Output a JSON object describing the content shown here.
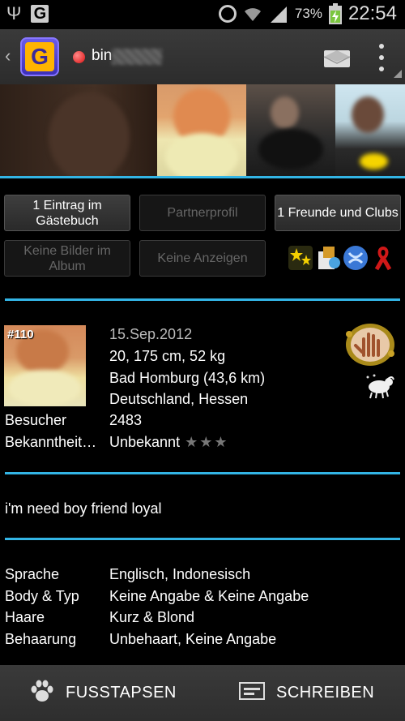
{
  "status_bar": {
    "battery_percent": "73%",
    "time": "22:54",
    "icons": [
      "usb-icon",
      "g-notification-icon",
      "alarm-icon",
      "wifi-icon",
      "signal-icon",
      "battery-charging-icon"
    ]
  },
  "action_bar": {
    "logo_letter": "G",
    "online_status_color": "#dd1111",
    "username": "bin",
    "icons": [
      "back-chevron-icon",
      "app-logo-icon",
      "mail-icon",
      "overflow-menu-icon"
    ]
  },
  "accent_color": "#33b5e5",
  "buttons": {
    "guestbook": "1 Eintrag im Gästebuch",
    "partner_profile": "Partnerprofil",
    "friends_clubs": "1 Freunde und Clubs",
    "no_pictures": "Keine Bilder im Album",
    "no_ads": "Keine Anzeigen"
  },
  "badges": [
    "stars-badge-icon",
    "tools-badge-icon",
    "globe-badge-icon",
    "red-ribbon-icon"
  ],
  "profile": {
    "rank": "#110",
    "date": "15.Sep.2012",
    "stats": "20, 175 cm, 52 kg",
    "city": "Bad Homburg (43,6 km)",
    "region": "Deutschland, Hessen",
    "visitors_label": "Besucher",
    "visitors_value": "2483",
    "popularity_label": "Bekanntheit…",
    "popularity_value": "Unbekannt",
    "stars": "★★★",
    "icons": [
      "footprint-hand-icon",
      "aries-zodiac-icon"
    ]
  },
  "bio": "i'm need boy friend loyal",
  "details": [
    {
      "label": "Sprache",
      "value": "Englisch, Indonesisch"
    },
    {
      "label": "Body & Typ",
      "value": "Keine Angabe & Keine Angabe"
    },
    {
      "label": "Haare",
      "value": "Kurz & Blond"
    },
    {
      "label": "Behaarung",
      "value": "Unbehaart, Keine Angabe"
    }
  ],
  "bottom_bar": {
    "footprints_label": "FUSSTAPSEN",
    "write_label": "SCHREIBEN"
  }
}
